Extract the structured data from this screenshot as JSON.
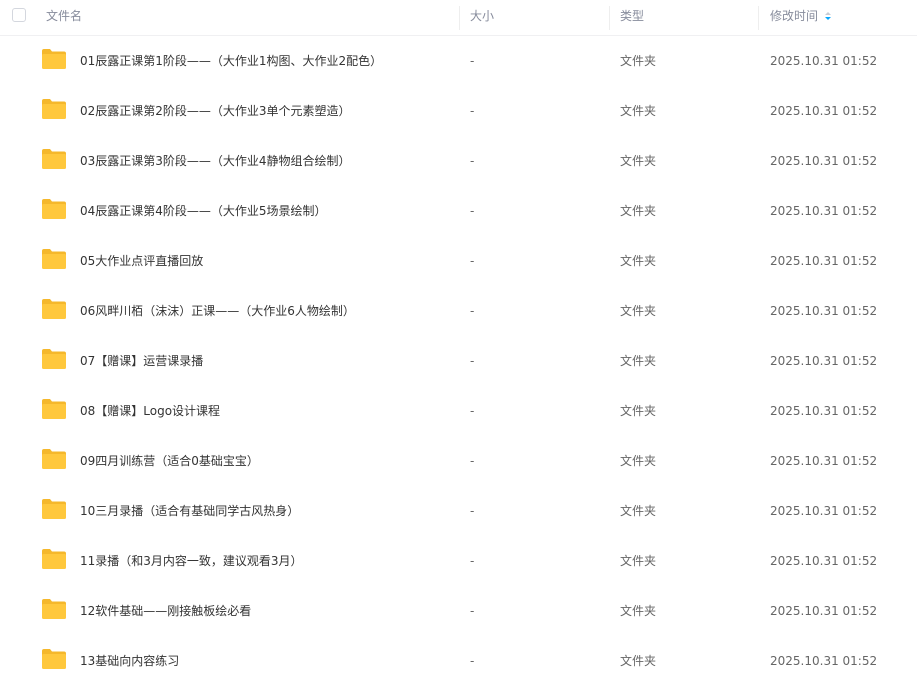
{
  "header": {
    "name": "文件名",
    "size": "大小",
    "type": "类型",
    "modified": "修改时间"
  },
  "colors": {
    "folder": "#ffc83d",
    "folder_tab": "#f5b82c",
    "sort_accent": "#06a7ff"
  },
  "files": [
    {
      "name": "01辰露正课第1阶段——（大作业1构图、大作业2配色）",
      "size": "-",
      "type": "文件夹",
      "modified": "2025.10.31 01:52"
    },
    {
      "name": "02辰露正课第2阶段——（大作业3单个元素塑造）",
      "size": "-",
      "type": "文件夹",
      "modified": "2025.10.31 01:52"
    },
    {
      "name": "03辰露正课第3阶段——（大作业4静物组合绘制）",
      "size": "-",
      "type": "文件夹",
      "modified": "2025.10.31 01:52"
    },
    {
      "name": "04辰露正课第4阶段——（大作业5场景绘制）",
      "size": "-",
      "type": "文件夹",
      "modified": "2025.10.31 01:52"
    },
    {
      "name": "05大作业点评直播回放",
      "size": "-",
      "type": "文件夹",
      "modified": "2025.10.31 01:52"
    },
    {
      "name": "06风畔川栢（沫沫）正课——（大作业6人物绘制）",
      "size": "-",
      "type": "文件夹",
      "modified": "2025.10.31 01:52"
    },
    {
      "name": "07【赠课】运营课录播",
      "size": "-",
      "type": "文件夹",
      "modified": "2025.10.31 01:52"
    },
    {
      "name": "08【赠课】Logo设计课程",
      "size": "-",
      "type": "文件夹",
      "modified": "2025.10.31 01:52"
    },
    {
      "name": "09四月训练营（适合0基础宝宝）",
      "size": "-",
      "type": "文件夹",
      "modified": "2025.10.31 01:52"
    },
    {
      "name": "10三月录播（适合有基础同学古风热身）",
      "size": "-",
      "type": "文件夹",
      "modified": "2025.10.31 01:52"
    },
    {
      "name": "11录播（和3月内容一致，建议观看3月）",
      "size": "-",
      "type": "文件夹",
      "modified": "2025.10.31 01:52"
    },
    {
      "name": "12软件基础——刚接触板绘必看",
      "size": "-",
      "type": "文件夹",
      "modified": "2025.10.31 01:52"
    },
    {
      "name": "13基础向内容练习",
      "size": "-",
      "type": "文件夹",
      "modified": "2025.10.31 01:52"
    }
  ]
}
